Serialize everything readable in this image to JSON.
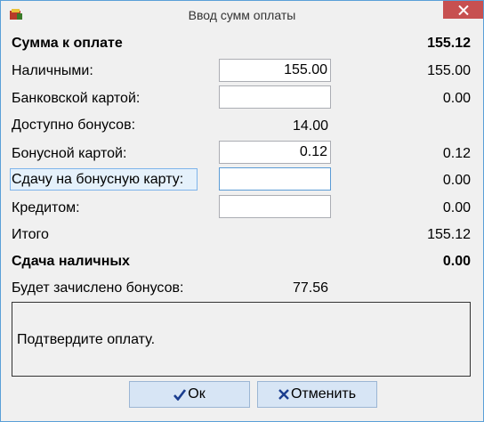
{
  "window": {
    "title": "Ввод сумм оплаты"
  },
  "form": {
    "total_label": "Сумма к оплате",
    "total_value": "155.12",
    "cash_label": "Наличными:",
    "cash_input": "155.00",
    "cash_value": "155.00",
    "card_label": "Банковской картой:",
    "card_input": "",
    "card_value": "0.00",
    "bonus_available_label": "Доступно бонусов:",
    "bonus_available_value": "14.00",
    "bonus_card_label": "Бонусной картой:",
    "bonus_card_input": "0.12",
    "bonus_card_value": "0.12",
    "change_to_bonus_label": "Сдачу на бонусную карту:",
    "change_to_bonus_input": "",
    "change_to_bonus_value": "0.00",
    "credit_label": "Кредитом:",
    "credit_input": "",
    "credit_value": "0.00",
    "itogo_label": "Итого",
    "itogo_value": "155.12",
    "change_cash_label": "Сдача наличных",
    "change_cash_value": "0.00",
    "bonus_credited_label": "Будет зачислено бонусов:",
    "bonus_credited_value": "77.56"
  },
  "message": "Подтвердите оплату.",
  "buttons": {
    "ok": "Ок",
    "cancel": "Отменить"
  },
  "colors": {
    "ok_check": "#1a3d8f",
    "cancel_x": "#1a3d8f",
    "close_bg": "#c75050"
  },
  "icons": {
    "app": "app-icon",
    "close": "close-icon",
    "ok": "checkmark-icon",
    "cancel": "x-icon"
  }
}
